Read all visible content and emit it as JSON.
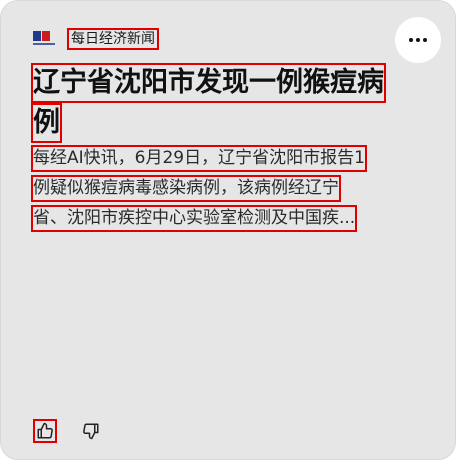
{
  "card": {
    "source": {
      "name": "每日经济新闻",
      "logo_icon": "news-logo-icon"
    },
    "more_button": {
      "icon": "more-horizontal-icon"
    },
    "headline_lines": [
      "辽宁省沈阳市发现一例猴痘病",
      "例"
    ],
    "summary_lines": [
      "每经AI快讯，6月29日，辽宁省沈阳市报告1",
      "例疑似猴痘病毒感染病例，该病例经辽宁",
      "省、沈阳市疾控中心实验室检测及中国疾..."
    ],
    "actions": {
      "like_icon": "thumbs-up-icon",
      "dislike_icon": "thumbs-down-icon"
    }
  }
}
